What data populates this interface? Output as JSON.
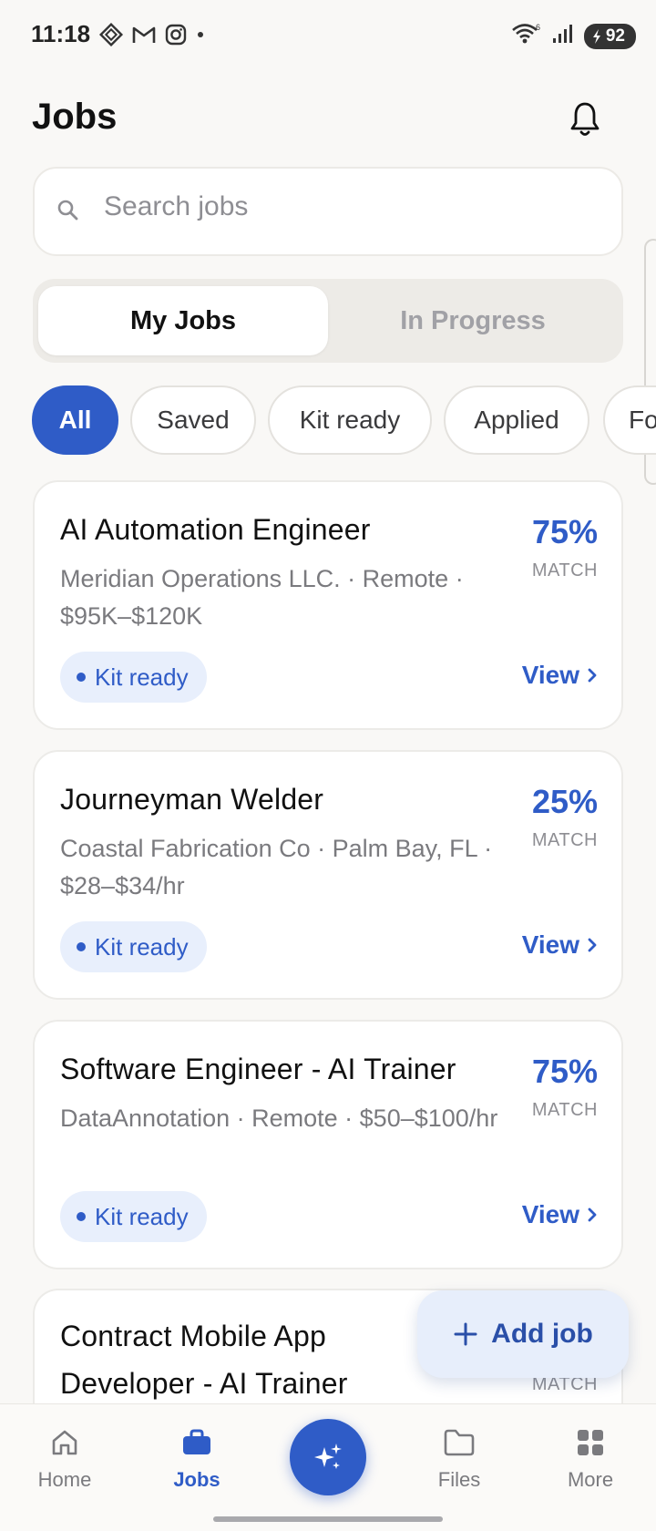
{
  "status_bar": {
    "time": "11:18",
    "battery": "92",
    "app_icons": [
      "diamond-app-icon",
      "gmail-icon",
      "instagram-icon",
      "notification-dot"
    ],
    "signal_label": "6"
  },
  "header": {
    "title": "Jobs"
  },
  "search": {
    "placeholder": "Search jobs"
  },
  "tabs": [
    {
      "label": "My Jobs",
      "active": true
    },
    {
      "label": "In Progress",
      "active": false
    }
  ],
  "filters": [
    {
      "label": "All",
      "active": true
    },
    {
      "label": "Saved",
      "active": false
    },
    {
      "label": "Kit ready",
      "active": false
    },
    {
      "label": "Applied",
      "active": false
    },
    {
      "label": "Fo",
      "active": false
    }
  ],
  "jobs": [
    {
      "title": "AI Automation Engineer",
      "meta": "Meridian Operations LLC. · Remote · $95K–$120K",
      "match_percent": "75%",
      "match_label": "MATCH",
      "badge": "Kit ready",
      "action": "View"
    },
    {
      "title": "Journeyman Welder",
      "meta": "Coastal Fabrication Co · Palm Bay, FL · $28–$34/hr",
      "match_percent": "25%",
      "match_label": "MATCH",
      "badge": "Kit ready",
      "action": "View"
    },
    {
      "title": "Software Engineer - AI Trainer",
      "meta": "DataAnnotation · Remote · $50–$100/hr",
      "match_percent": "75%",
      "match_label": "MATCH",
      "badge": "Kit ready",
      "action": "View"
    },
    {
      "title": "Contract Mobile App Developer - AI Trainer",
      "match_label": "MATCH"
    }
  ],
  "fab": {
    "label": "Add job"
  },
  "bottom_nav": [
    {
      "label": "Home",
      "icon": "home-icon",
      "active": false
    },
    {
      "label": "Jobs",
      "icon": "briefcase-icon",
      "active": true
    },
    {
      "label": "",
      "icon": "sparkles-icon",
      "active": false
    },
    {
      "label": "Files",
      "icon": "folder-icon",
      "active": false
    },
    {
      "label": "More",
      "icon": "grid-icon",
      "active": false
    }
  ],
  "colors": {
    "accent": "#2f5cc7",
    "background": "#f9f8f6",
    "badge_bg": "#e8effc",
    "muted_text": "#7a7a7e"
  }
}
